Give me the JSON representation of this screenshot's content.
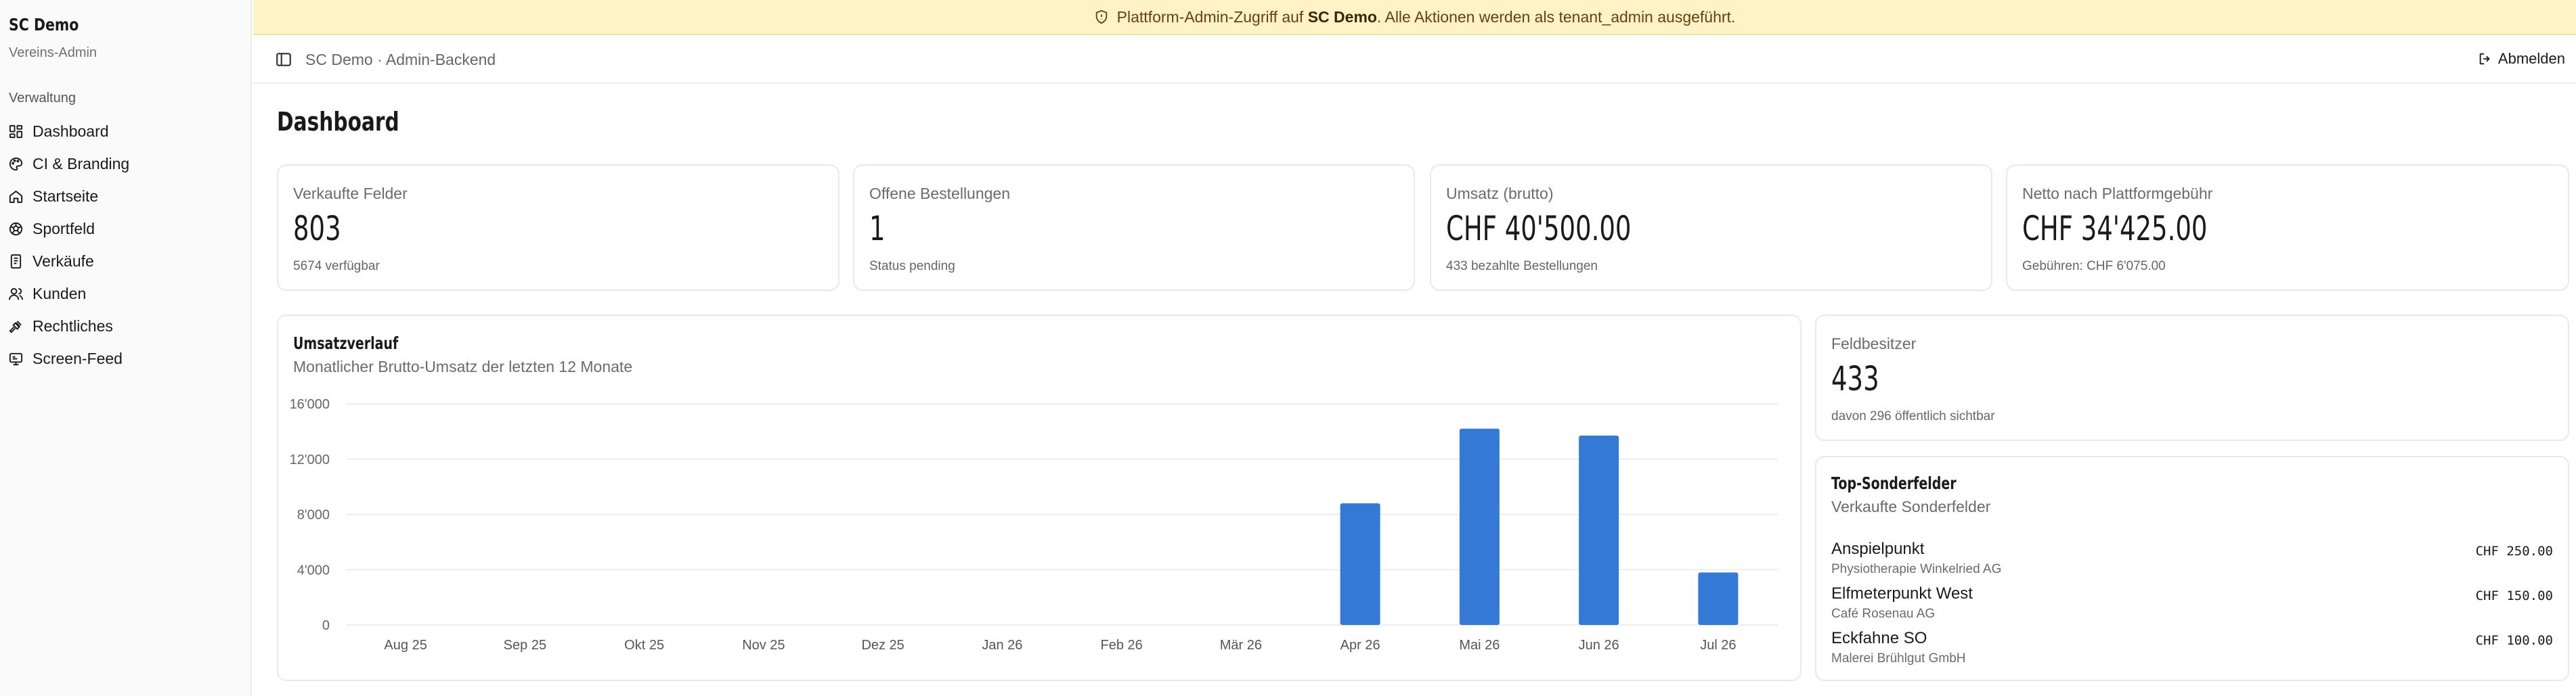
{
  "sidebar": {
    "brand": "SC Demo",
    "subtitle": "Vereins-Admin",
    "section": "Verwaltung",
    "items": [
      {
        "label": "Dashboard",
        "icon": "dashboard-icon"
      },
      {
        "label": "CI & Branding",
        "icon": "palette-icon"
      },
      {
        "label": "Startseite",
        "icon": "home-icon"
      },
      {
        "label": "Sportfeld",
        "icon": "ball-icon"
      },
      {
        "label": "Verkäufe",
        "icon": "receipt-icon"
      },
      {
        "label": "Kunden",
        "icon": "users-icon"
      },
      {
        "label": "Rechtliches",
        "icon": "gavel-icon"
      },
      {
        "label": "Screen-Feed",
        "icon": "screen-icon"
      }
    ]
  },
  "banner": {
    "prefix": "Plattform-Admin-Zugriff auf",
    "club": "SC Demo",
    "suffix": ". Alle Aktionen werden als tenant_admin ausgeführt."
  },
  "topbar": {
    "breadcrumb": "SC Demo · Admin-Backend",
    "logout": "Abmelden"
  },
  "page": {
    "title": "Dashboard"
  },
  "stats": [
    {
      "label": "Verkaufte Felder",
      "value": "803",
      "sub": "5674 verfügbar"
    },
    {
      "label": "Offene Bestellungen",
      "value": "1",
      "sub": "Status pending"
    },
    {
      "label": "Umsatz (brutto)",
      "value": "CHF 40'500.00",
      "sub": "433 bezahlte Bestellungen"
    },
    {
      "label": "Netto nach Plattformgebühr",
      "value": "CHF 34'425.00",
      "sub": "Gebühren: CHF 6'075.00"
    }
  ],
  "owners": {
    "label": "Feldbesitzer",
    "value": "433",
    "sub": "davon 296 öffentlich sichtbar"
  },
  "chart_data": {
    "type": "bar",
    "title": "Umsatzverlauf",
    "subtitle": "Monatlicher Brutto-Umsatz der letzten 12 Monate",
    "categories": [
      "Aug 25",
      "Sep 25",
      "Okt 25",
      "Nov 25",
      "Dez 25",
      "Jan 26",
      "Feb 26",
      "Mär 26",
      "Apr 26",
      "Mai 26",
      "Jun 26",
      "Jul 26"
    ],
    "values": [
      0,
      0,
      0,
      0,
      0,
      0,
      0,
      0,
      8800,
      14200,
      13700,
      3800
    ],
    "yticks": [
      0,
      4000,
      8000,
      12000,
      16000
    ],
    "ytick_labels": [
      "0",
      "4'000",
      "8'000",
      "12'000",
      "16'000"
    ],
    "ylim": [
      0,
      16000
    ],
    "grid": true,
    "color": "#3479d6"
  },
  "special_fields": {
    "title": "Top-Sonderfelder",
    "subtitle": "Verkaufte Sonderfelder",
    "items": [
      {
        "name": "Anspielpunkt",
        "owner": "Physiotherapie Winkelried AG",
        "price": "CHF 250.00"
      },
      {
        "name": "Elfmeterpunkt West",
        "owner": "Café Rosenau AG",
        "price": "CHF 150.00"
      },
      {
        "name": "Eckfahne SO",
        "owner": "Malerei Brühlgut GmbH",
        "price": "CHF 100.00"
      }
    ]
  }
}
